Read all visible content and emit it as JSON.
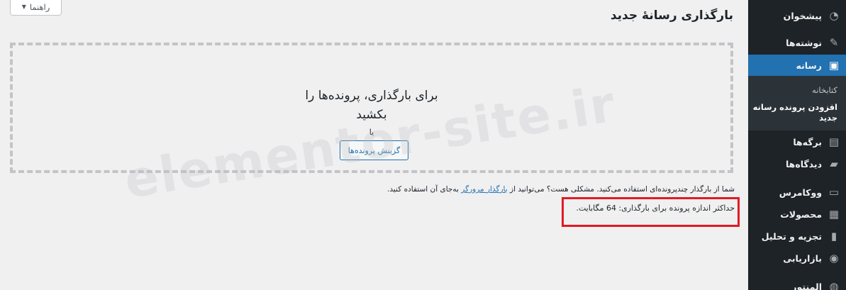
{
  "sidebar": {
    "items": [
      {
        "label": "پیشخوان",
        "icon": "dashboard-icon",
        "glyph": "◔",
        "name": "sidebar-item-dashboard"
      },
      {
        "label": "نوشته‌ها",
        "icon": "pin-icon",
        "glyph": "✎",
        "name": "sidebar-item-posts"
      },
      {
        "label": "رسانه",
        "icon": "media-icon",
        "glyph": "▣",
        "name": "sidebar-item-media"
      },
      {
        "label": "برگه‌ها",
        "icon": "pages-icon",
        "glyph": "▤",
        "name": "sidebar-item-pages"
      },
      {
        "label": "دیدگاه‌ها",
        "icon": "comments-icon",
        "glyph": "▰",
        "name": "sidebar-item-comments"
      },
      {
        "label": "ووکامرس",
        "icon": "woocommerce-icon",
        "glyph": "▭",
        "name": "sidebar-item-woocommerce"
      },
      {
        "label": "محصولات",
        "icon": "products-icon",
        "glyph": "▦",
        "name": "sidebar-item-products"
      },
      {
        "label": "تجزیه و تحلیل",
        "icon": "analytics-icon",
        "glyph": "▮",
        "name": "sidebar-item-analytics"
      },
      {
        "label": "بازاریابی",
        "icon": "megaphone-icon",
        "glyph": "◉",
        "name": "sidebar-item-marketing"
      },
      {
        "label": "المنتور",
        "icon": "elementor-icon",
        "glyph": "◍",
        "name": "sidebar-item-elementor"
      }
    ],
    "submenu": {
      "library": "کتابخانه",
      "add_new": "افزودن پرونده رسانه جدید"
    }
  },
  "help_button": "راهنما",
  "page_title": "بارگذاری رسانهٔ جدید",
  "dropzone": {
    "line1": "برای بارگذاری، پرونده‌ها را",
    "line2": "بکشید",
    "or": "یا",
    "select_button": "گزینش پرونده‌ها"
  },
  "info": {
    "text_before": "شما از بارگذار چندپرونده‌ای استفاده می‌کنید. مشکلی هست؟ می‌توانید از ",
    "link": "بارگذار مرورگر",
    "text_after": " به‌جای آن استفاده کنید.",
    "max_size": "حداکثر اندازه پرونده برای بارگذاری: 64 مگابایت."
  },
  "watermark": "elementor-site.ir",
  "colors": {
    "sidebar_bg": "#1d2327",
    "active_bg": "#2271b1",
    "highlight": "#e01b24",
    "link": "#2271b1"
  }
}
